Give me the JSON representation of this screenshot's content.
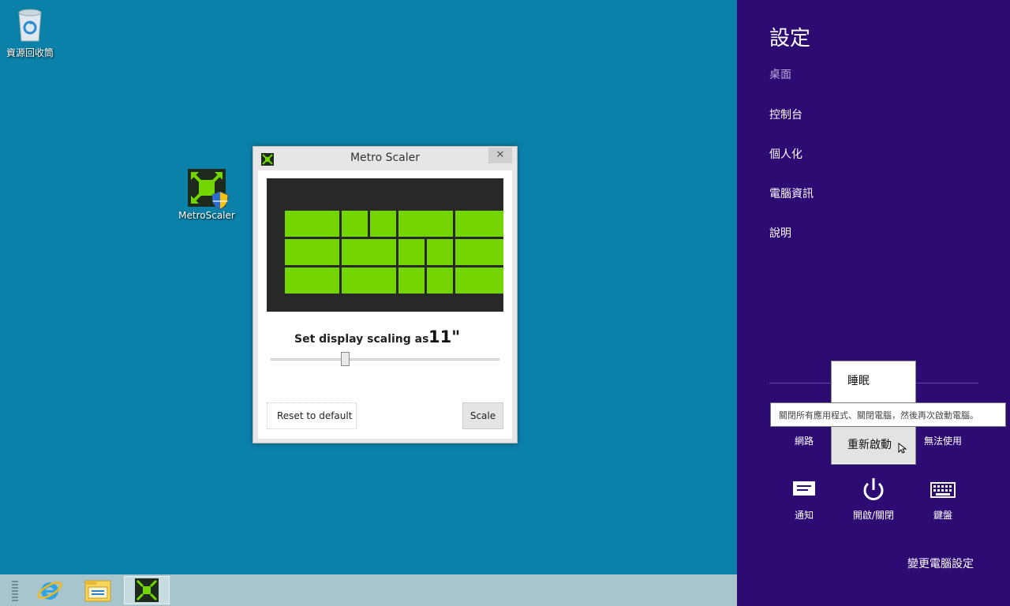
{
  "desktop": {
    "icons": [
      {
        "label": "資源回收筒",
        "icon": "recycle-bin-icon"
      },
      {
        "label": "MetroScaler",
        "icon": "metroscaler-icon"
      }
    ]
  },
  "dialog": {
    "title": "Metro Scaler",
    "close_glyph": "✕",
    "scale_label": "Set display scaling as",
    "scale_value": "11\"",
    "reset_label": "Reset to default",
    "scale_button_label": "Scale",
    "slider_fraction": 0.32
  },
  "taskbar": {
    "items": [
      "internet-explorer-icon",
      "file-explorer-icon",
      "metroscaler-icon"
    ]
  },
  "charms": {
    "title": "設定",
    "subtitle": "桌面",
    "links": [
      "控制台",
      "個人化",
      "電腦資訊",
      "說明"
    ],
    "tray": {
      "network": "網路",
      "unavailable": "無法使用",
      "notifications": "通知",
      "power": "開啟/關閉",
      "keyboard": "鍵盤"
    },
    "change_settings": "變更電腦設定"
  },
  "power_menu": {
    "sleep": "睡眠",
    "restart": "重新啟動",
    "tooltip": "關閉所有應用程式、關閉電腦，然後再次啟動電腦。"
  },
  "colors": {
    "desktop_bg": "#0b80a8",
    "charms_bg": "#2c0b73",
    "tile_green": "#74d600",
    "taskbar_bg": "#a8c4cc"
  }
}
